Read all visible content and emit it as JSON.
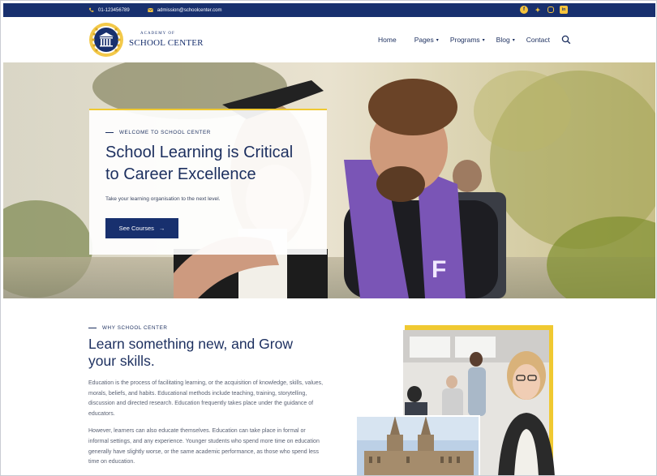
{
  "topbar": {
    "phone": "01-123456789",
    "email": "admission@schoolcenter.com",
    "socials": [
      "facebook-icon",
      "twitter-icon",
      "instagram-icon",
      "linkedin-icon"
    ]
  },
  "logo": {
    "line1": "ACADEMY OF",
    "line2": "SCHOOL CENTER"
  },
  "nav": {
    "items": [
      {
        "label": "Home",
        "dropdown": false
      },
      {
        "label": "Pages",
        "dropdown": true
      },
      {
        "label": "Programs",
        "dropdown": true
      },
      {
        "label": "Blog",
        "dropdown": true
      },
      {
        "label": "Contact",
        "dropdown": false
      }
    ]
  },
  "hero": {
    "eyebrow": "WELCOME TO SCHOOL CENTER",
    "title_line1": "School Learning is Critical",
    "title_line2": "to Career Excellence",
    "subtitle": "Take your learning organisation to the next level.",
    "button": "See Courses"
  },
  "why": {
    "eyebrow": "WHY SCHOOL CENTER",
    "title_line1": "Learn something new, and Grow",
    "title_line2": "your skills.",
    "p1": "Education is the process of facilitating learning, or the acquisition of knowledge, skills, values, morals, beliefs, and habits. Educational methods include teaching, training, storytelling, discussion and directed research. Education frequently takes place under the guidance of educators.",
    "p2": "However, learners can also educate themselves. Education can take place in formal or informal settings, and any experience. Younger students who spend more time on education generally have slightly worse, or the same academic performance, as those who spend less time on education."
  },
  "colors": {
    "navy": "#18306e",
    "accent": "#f0c931",
    "text": "#1c2f5f"
  }
}
